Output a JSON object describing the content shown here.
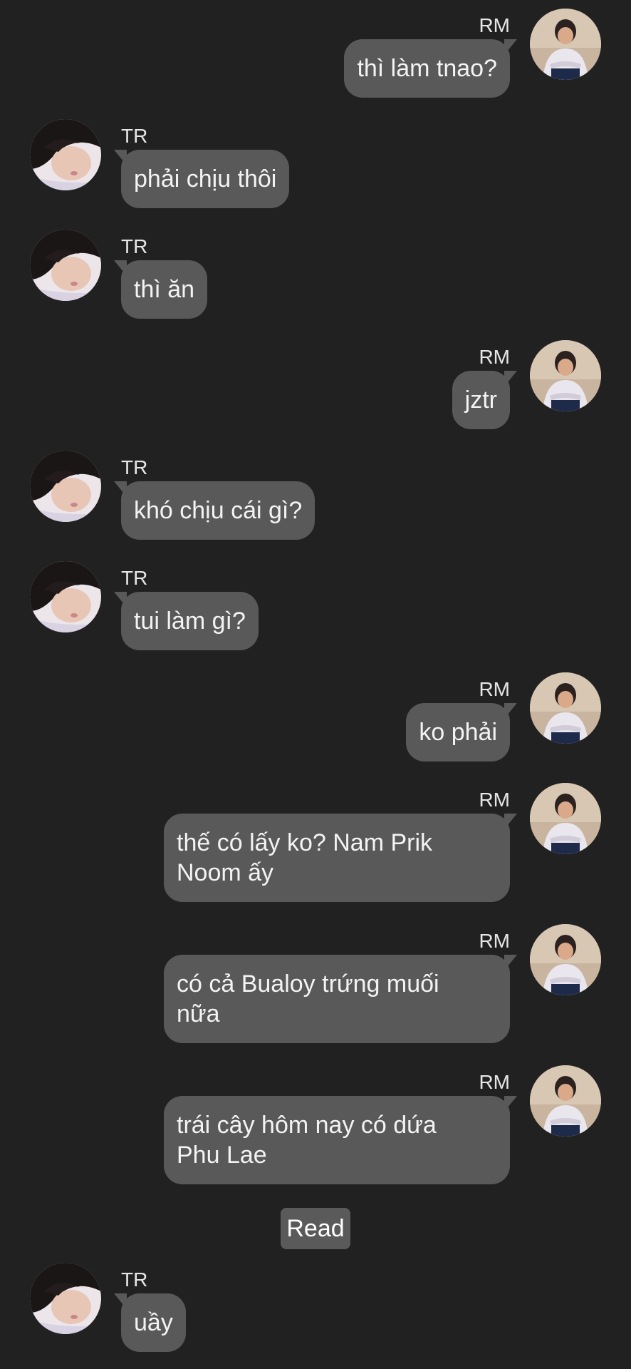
{
  "contacts": {
    "me": {
      "name": "RM"
    },
    "other": {
      "name": "TR"
    }
  },
  "messages": [
    {
      "sender": "RM",
      "text": "thì làm tnao?"
    },
    {
      "sender": "TR",
      "text": "phải chịu thôi"
    },
    {
      "sender": "TR",
      "text": "thì ăn"
    },
    {
      "sender": "RM",
      "text": "jztr"
    },
    {
      "sender": "TR",
      "text": "khó chịu cái gì?"
    },
    {
      "sender": "TR",
      "text": "tui làm gì?"
    },
    {
      "sender": "RM",
      "text": "ko phải"
    },
    {
      "sender": "RM",
      "text": "thế có lấy ko? Nam Prik\nNoom ấy"
    },
    {
      "sender": "RM",
      "text": "có cả Bualoy trứng muối\nnữa"
    },
    {
      "sender": "RM",
      "text": "trái cây hôm nay có dứa\nPhu Lae"
    },
    {
      "sender": "TR",
      "text": "uầy"
    }
  ],
  "read_receipt": "Read",
  "colors": {
    "background": "#212121",
    "bubble": "#595959",
    "text": "#f3f3f3"
  },
  "icons": {
    "me_avatar": "profile-photo-person-seated",
    "other_avatar": "profile-photo-person-lying"
  }
}
